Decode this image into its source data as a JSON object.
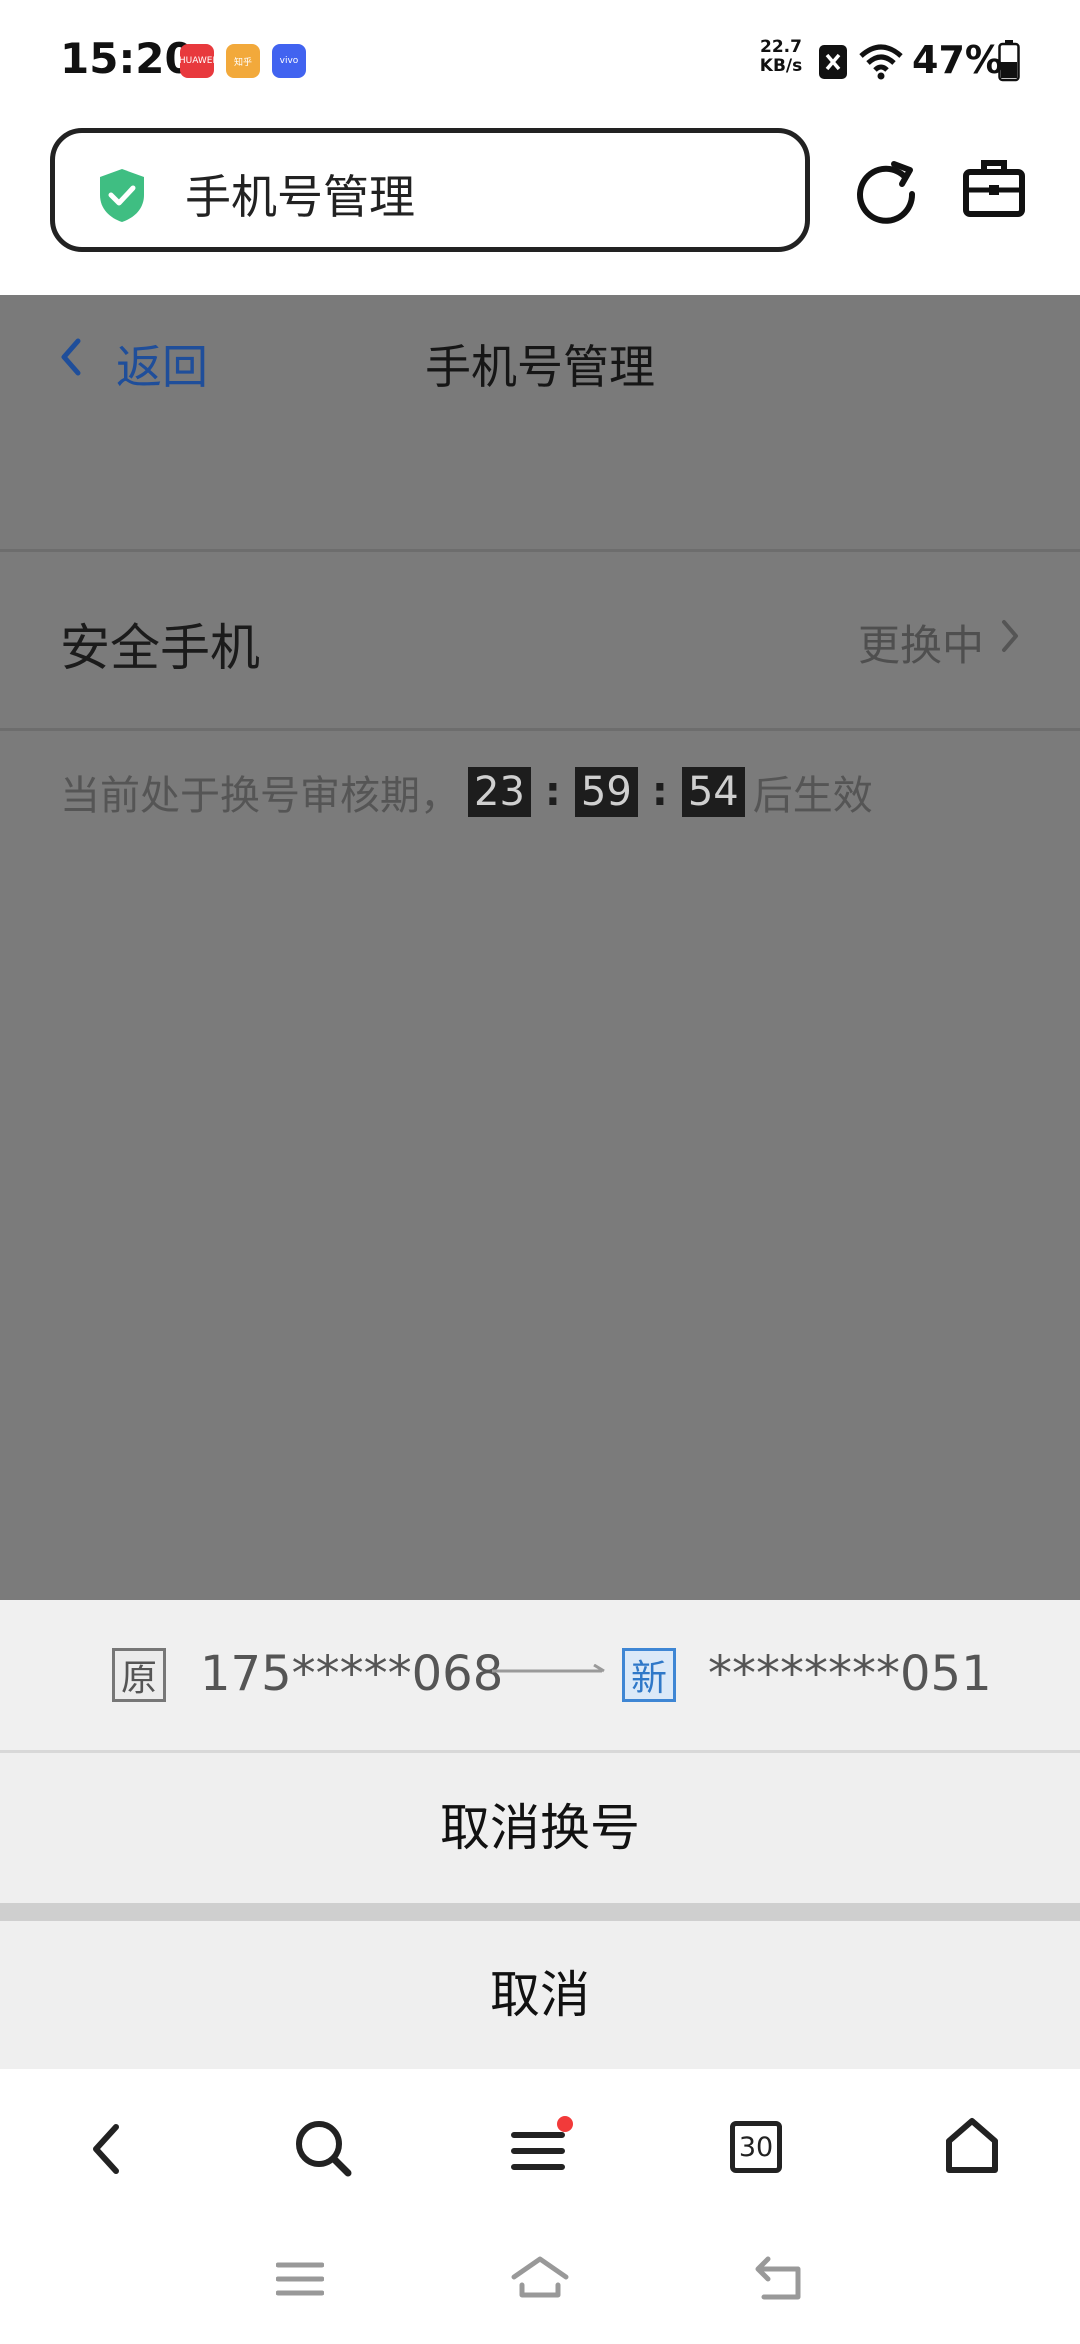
{
  "status_bar": {
    "time": "15:20",
    "apps": [
      {
        "name": "huawei-app-icon",
        "label": "HUAWEI",
        "color": "#e8393d"
      },
      {
        "name": "zhihu-app-icon",
        "label": "知乎",
        "color": "#f2a93b"
      },
      {
        "name": "vivo-app-icon",
        "label": "vivo",
        "color": "#4163f0"
      }
    ],
    "net_speed_value": "22.7",
    "net_speed_unit": "KB/s",
    "battery": "47%"
  },
  "browser": {
    "address_title": "手机号管理"
  },
  "page": {
    "back_label": "返回",
    "title": "手机号管理",
    "safe_phone_label": "安全手机",
    "safe_phone_status": "更换中",
    "notice_prefix": "当前处于换号审核期，",
    "timer": {
      "hours": "23",
      "minutes": "59",
      "seconds": "54"
    },
    "notice_suffix": "后生效"
  },
  "sheet": {
    "old_tag": "原",
    "old_number": "175*****068",
    "new_tag": "新",
    "new_number": "********051",
    "cancel_change_label": "取消换号",
    "cancel_label": "取消"
  },
  "bottom_nav": {
    "tabs_count": "30"
  }
}
